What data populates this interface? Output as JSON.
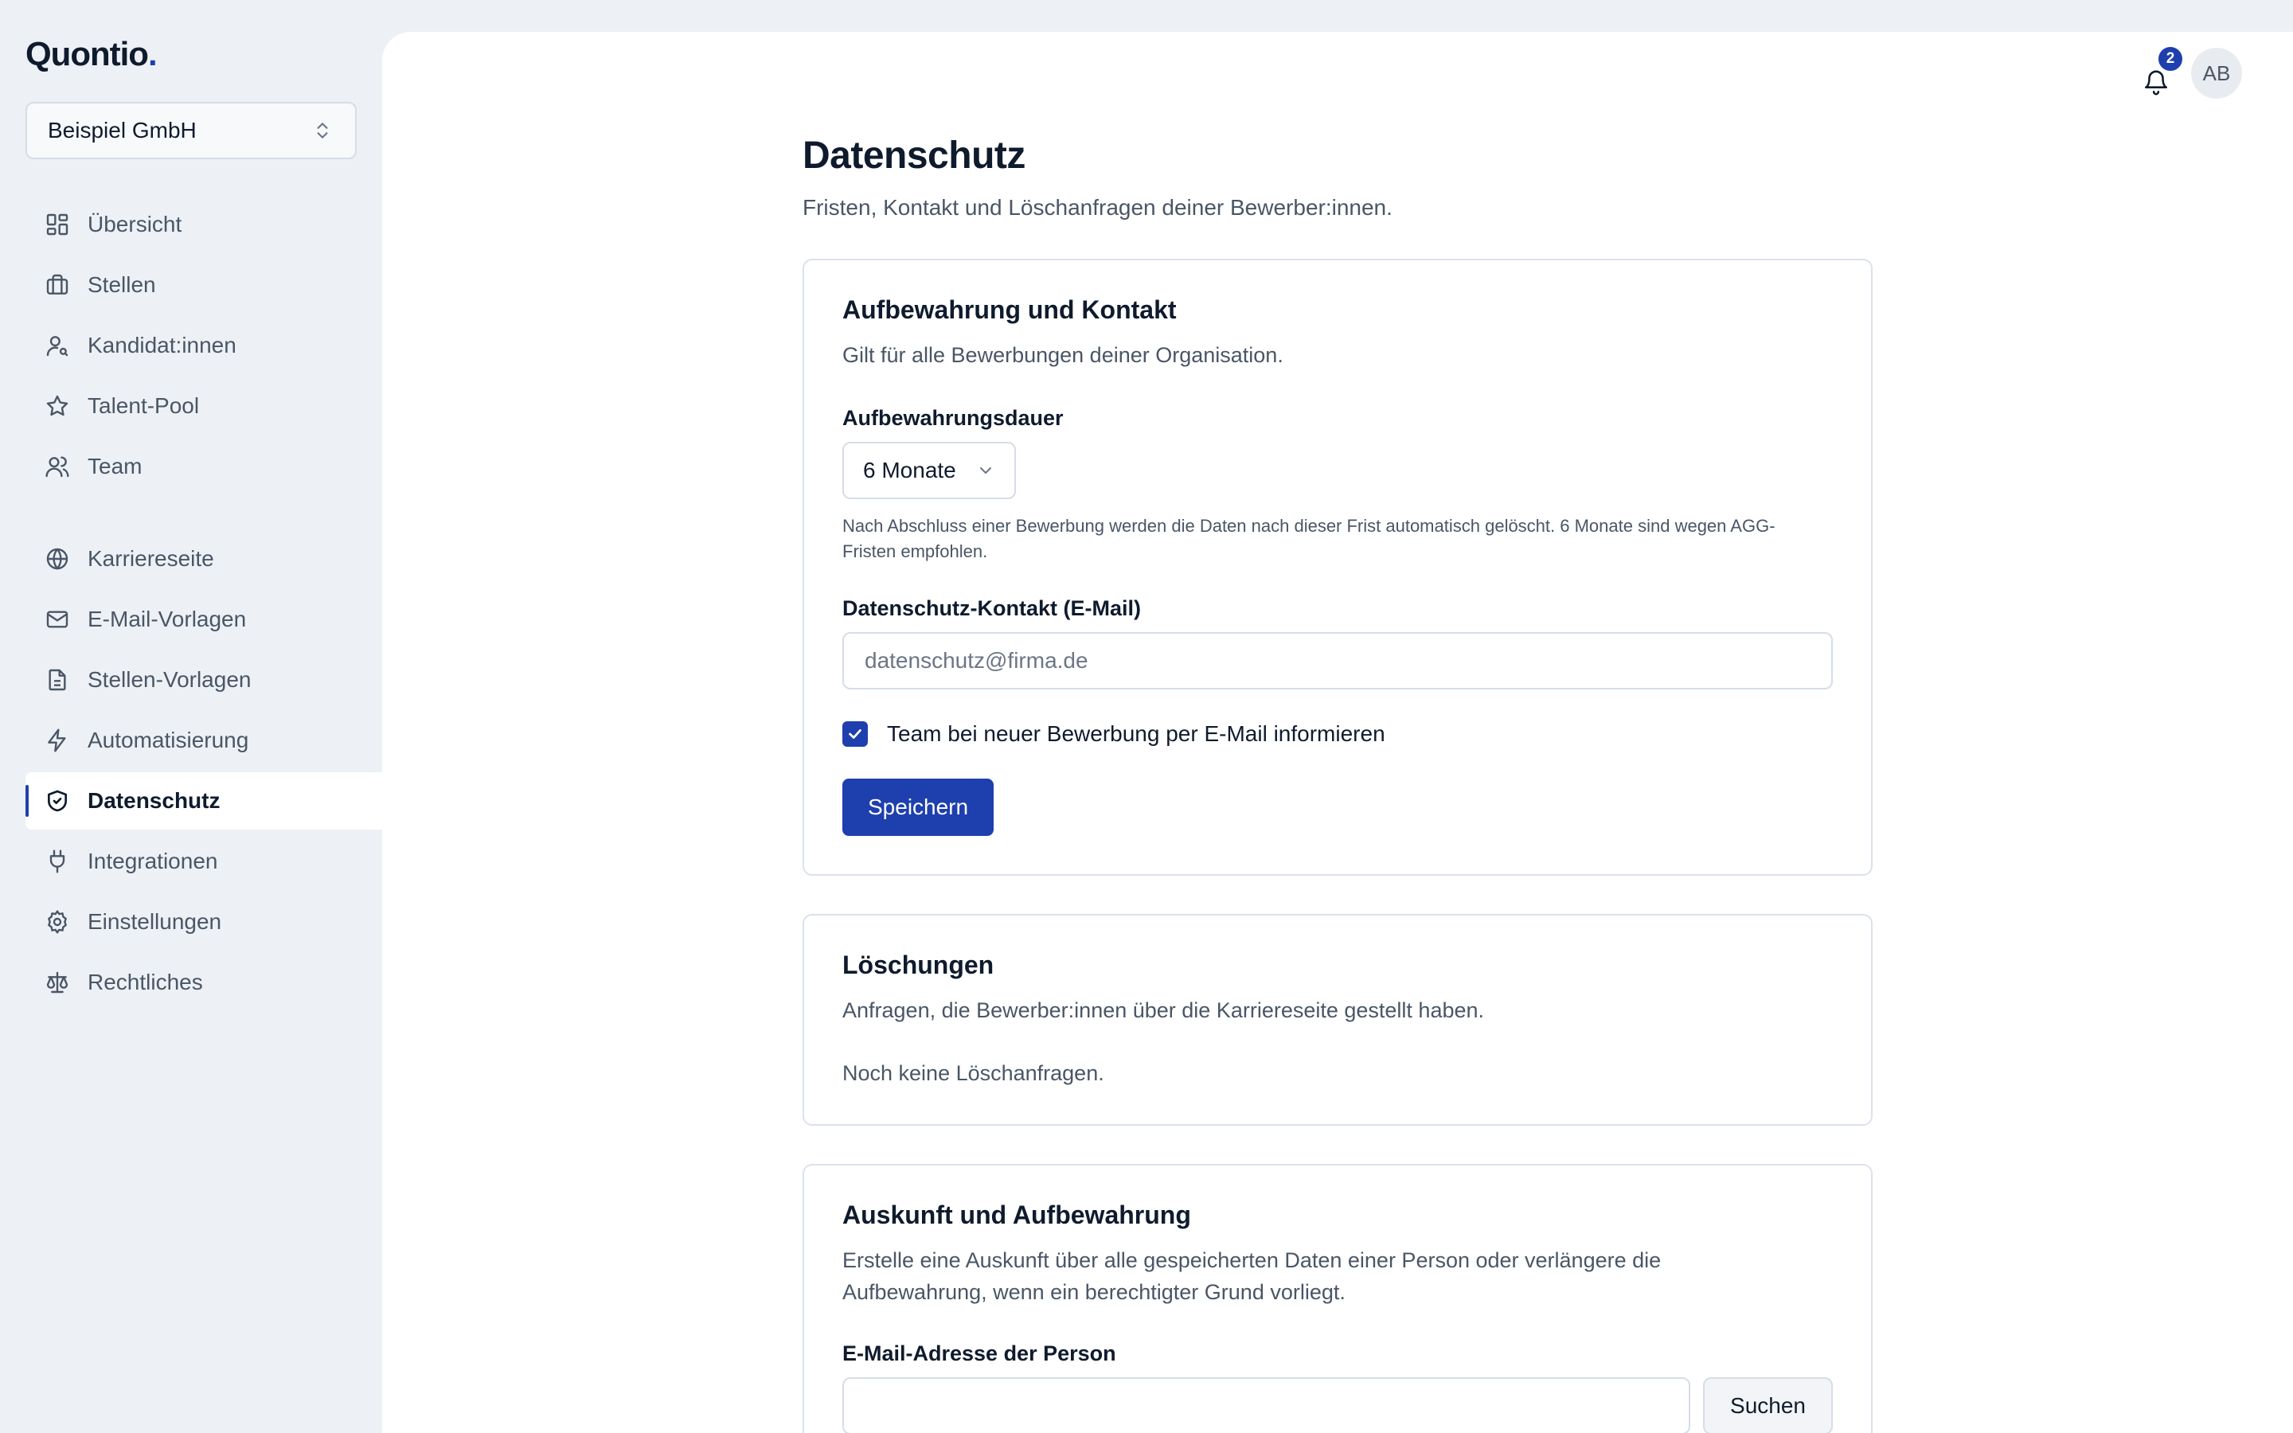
{
  "brand": {
    "name": "Quontio",
    "dot": "."
  },
  "org": {
    "name": "Beispiel GmbH"
  },
  "nav": {
    "group1": [
      {
        "label": "Übersicht",
        "icon": "dashboard-icon"
      },
      {
        "label": "Stellen",
        "icon": "briefcase-icon"
      },
      {
        "label": "Kandidat:innen",
        "icon": "user-search-icon"
      },
      {
        "label": "Talent-Pool",
        "icon": "star-icon"
      },
      {
        "label": "Team",
        "icon": "users-icon"
      }
    ],
    "group2": [
      {
        "label": "Karriereseite",
        "icon": "globe-icon"
      },
      {
        "label": "E-Mail-Vorlagen",
        "icon": "mail-icon"
      },
      {
        "label": "Stellen-Vorlagen",
        "icon": "document-icon"
      },
      {
        "label": "Automatisierung",
        "icon": "lightning-icon"
      },
      {
        "label": "Datenschutz",
        "icon": "shield-check-icon",
        "active": true
      },
      {
        "label": "Integrationen",
        "icon": "plug-icon"
      },
      {
        "label": "Einstellungen",
        "icon": "gear-icon"
      },
      {
        "label": "Rechtliches",
        "icon": "scale-icon"
      }
    ]
  },
  "header": {
    "notifications_count": "2",
    "avatar_initials": "AB"
  },
  "page": {
    "title": "Datenschutz",
    "subtitle": "Fristen, Kontakt und Löschanfragen deiner Bewerber:innen."
  },
  "retention_card": {
    "title": "Aufbewahrung und Kontakt",
    "subtitle": "Gilt für alle Bewerbungen deiner Organisation.",
    "duration_label": "Aufbewahrungsdauer",
    "duration_value": "6 Monate",
    "duration_hint": "Nach Abschluss einer Bewerbung werden die Daten nach dieser Frist automatisch gelöscht. 6 Monate sind wegen AGG-Fristen empfohlen.",
    "contact_label": "Datenschutz-Kontakt (E-Mail)",
    "contact_placeholder": "datenschutz@firma.de",
    "notify_label": "Team bei neuer Bewerbung per E-Mail informieren",
    "notify_checked": true,
    "save_label": "Speichern"
  },
  "deletions_card": {
    "title": "Löschungen",
    "subtitle": "Anfragen, die Bewerber:innen über die Karriereseite gestellt haben.",
    "empty": "Noch keine Löschanfragen."
  },
  "info_card": {
    "title": "Auskunft und Aufbewahrung",
    "subtitle": "Erstelle eine Auskunft über alle gespeicherten Daten einer Person oder verlängere die Aufbewahrung, wenn ein berechtigter Grund vorliegt.",
    "email_label": "E-Mail-Adresse der Person",
    "email_placeholder": "",
    "search_label": "Suchen"
  },
  "colors": {
    "accent": "#1e3fae",
    "sidebar_bg": "#edf1f5",
    "text_muted": "#4a5666"
  }
}
